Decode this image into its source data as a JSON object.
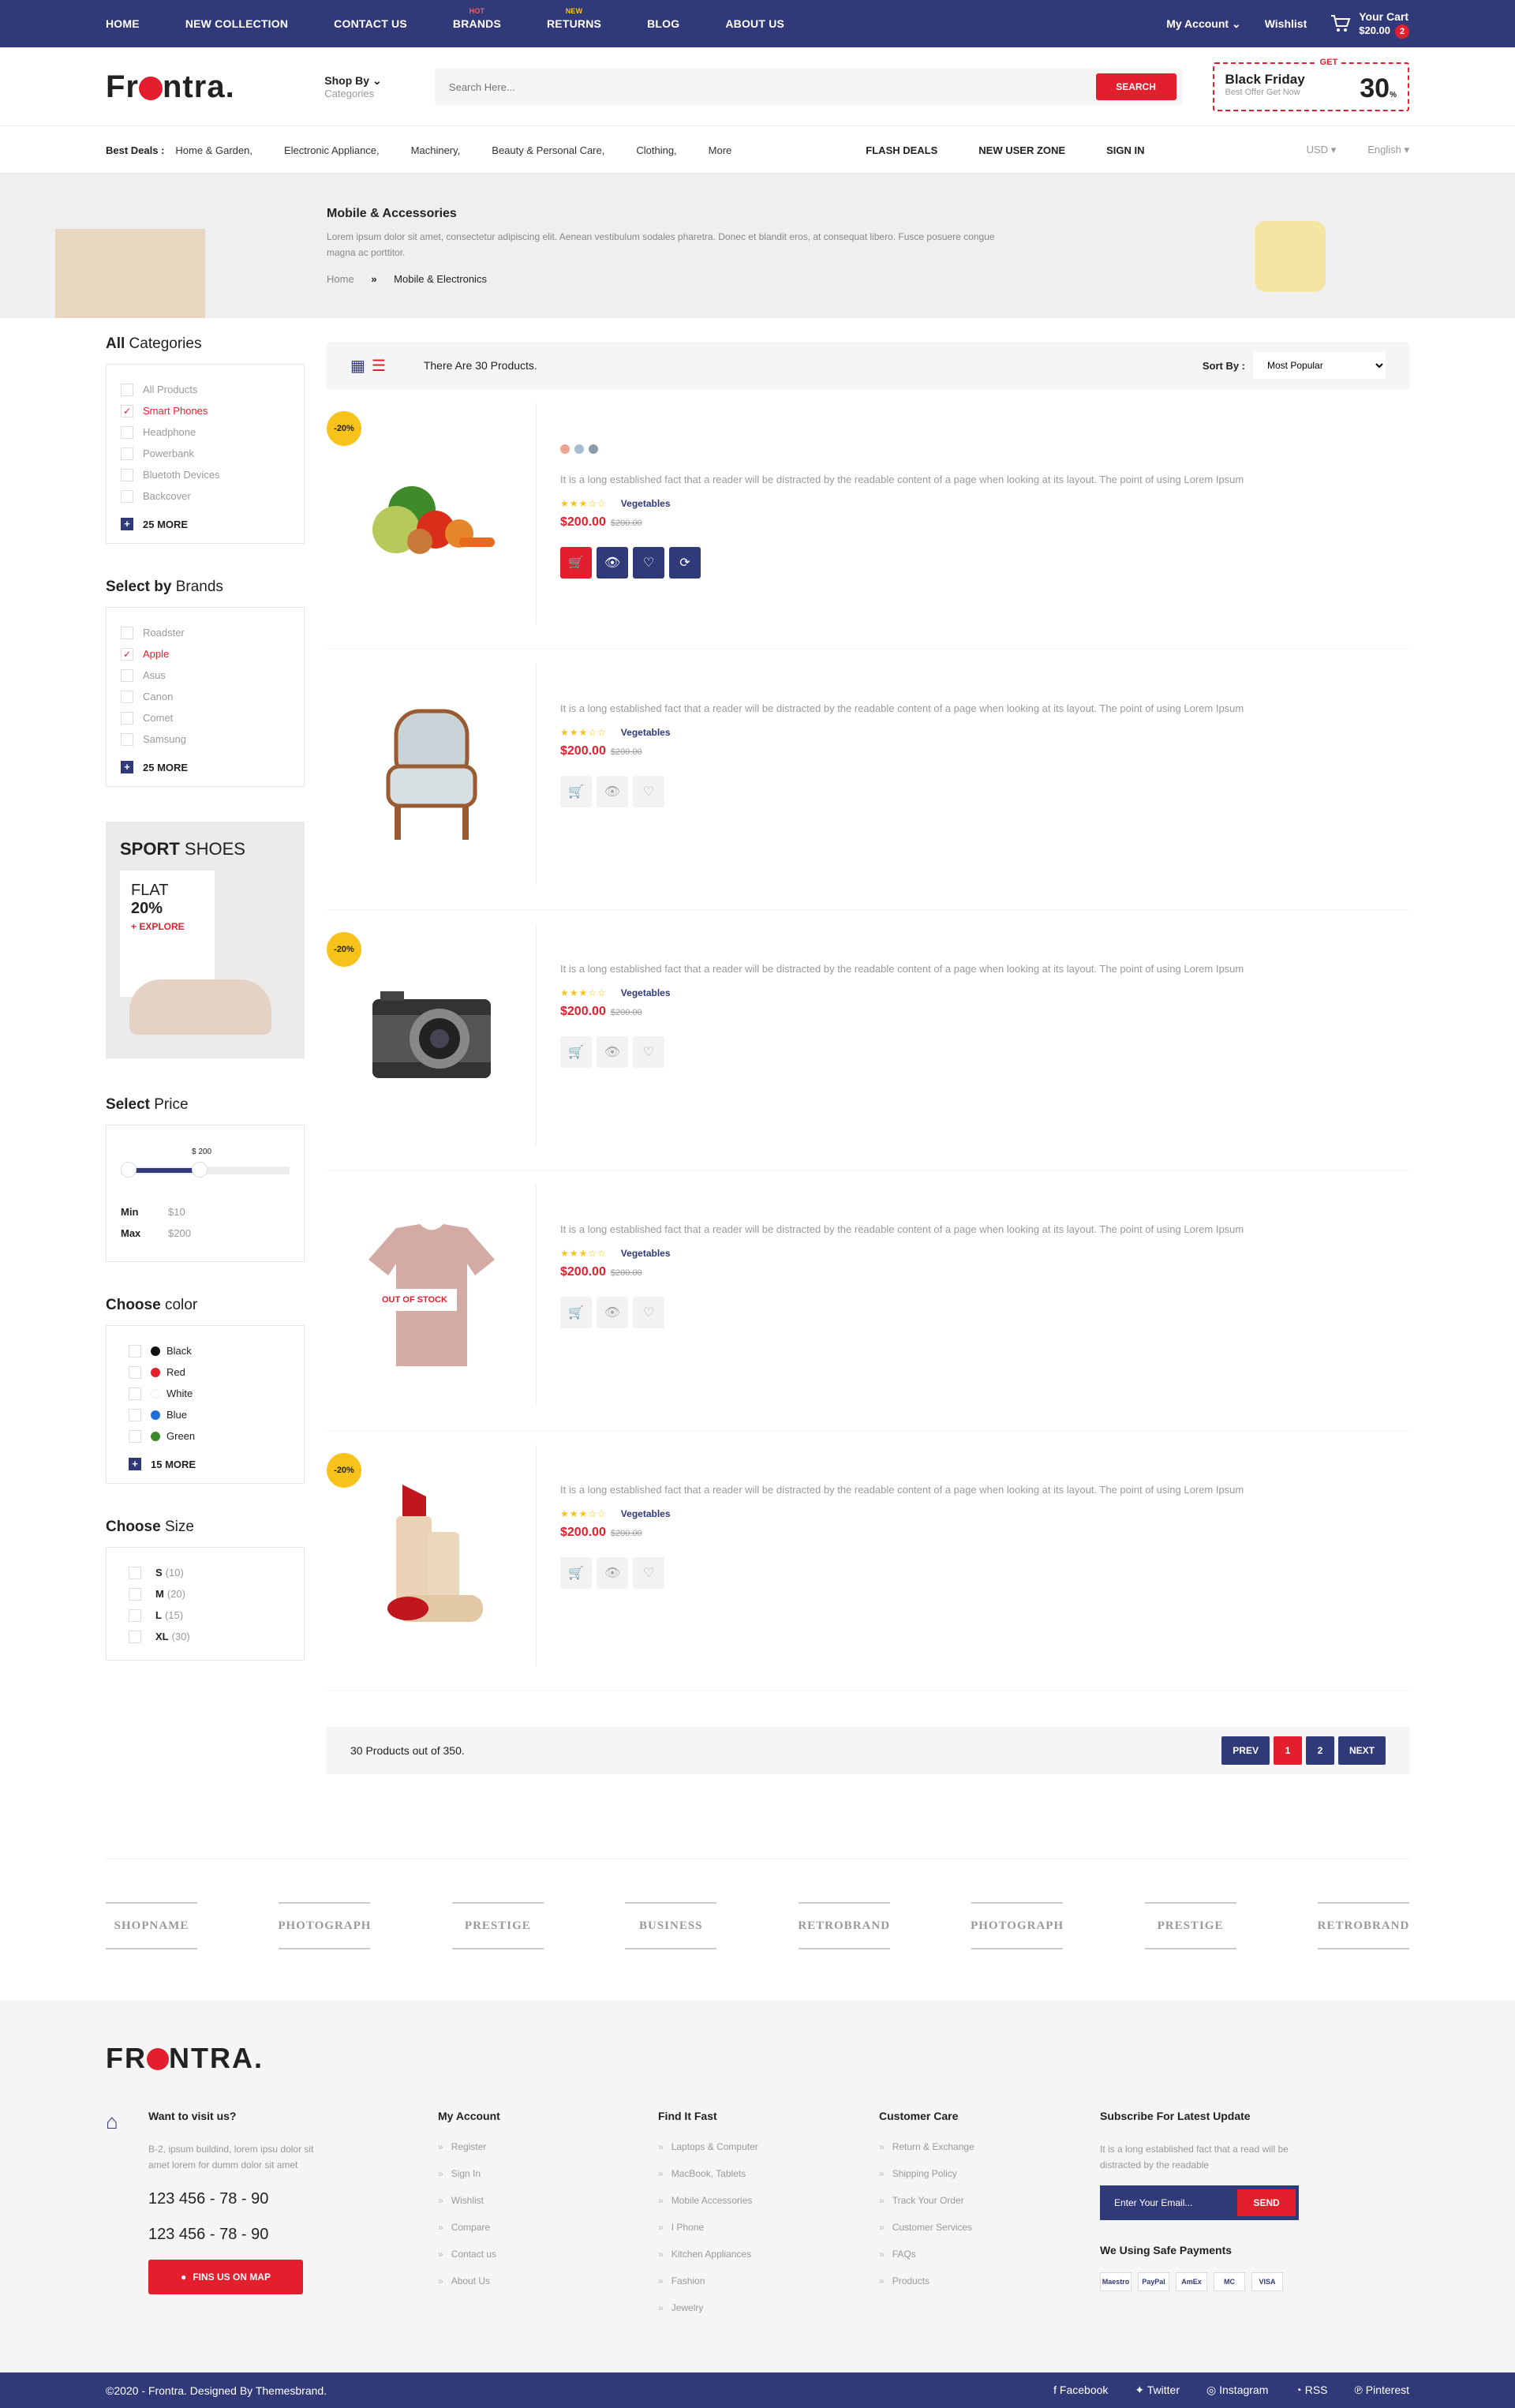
{
  "topbar": {
    "nav": [
      {
        "label": "HOME",
        "tag": ""
      },
      {
        "label": "NEW COLLECTION",
        "tag": ""
      },
      {
        "label": "CONTACT US",
        "tag": ""
      },
      {
        "label": "BRANDS",
        "tag": "HOT"
      },
      {
        "label": "RETURNS",
        "tag": "NEW"
      },
      {
        "label": "BLOG",
        "tag": ""
      },
      {
        "label": "ABOUT US",
        "tag": ""
      }
    ],
    "account": "My Account",
    "wishlist": "Wishlist",
    "cart_title": "Your Cart",
    "cart_total": "$20.00",
    "cart_count": "2"
  },
  "header": {
    "logo_pre": "Fr",
    "logo_post": "ntra.",
    "shopby": "Shop By",
    "shopby_sub": "Categories",
    "search_placeholder": "Search Here...",
    "search_button": "SEARCH",
    "promo_get": "GET",
    "promo_title": "Black Friday",
    "promo_sub": "Best Offer Get Now",
    "promo_pct": "30",
    "promo_pct_sign": "%"
  },
  "catbar": {
    "label": "Best Deals :",
    "cats": [
      "Home & Garden,",
      "Electronic Appliance,",
      "Machinery,",
      "Beauty & Personal Care,",
      "Clothing,",
      "More"
    ],
    "right": [
      "FLASH DEALS",
      "NEW USER ZONE",
      "SIGN IN"
    ],
    "currency": "USD",
    "language": "English"
  },
  "banner": {
    "title": "Mobile & Accessories",
    "text": "Lorem ipsum dolor sit amet, consectetur adipiscing elit. Aenean vestibulum sodales pharetra. Donec et blandit eros, at consequat libero. Fusce posuere congue magna ac porttitor.",
    "crumb_home": "Home",
    "crumb_sep": "»",
    "crumb_current": "Mobile & Electronics"
  },
  "sidebar": {
    "categories_title_a": "All",
    "categories_title_b": " Categories",
    "categories": [
      "All Products",
      "Smart Phones",
      "Headphone",
      "Powerbank",
      "Bluetoth Devices",
      "Backcover"
    ],
    "categories_more": "25 MORE",
    "brands_title_a": "Select by",
    "brands_title_b": " Brands",
    "brands": [
      "Roadster",
      "Apple",
      "Asus",
      "Canon",
      "Comet",
      "Samsung"
    ],
    "brands_more": "25 MORE",
    "ad_title_a": "SPORT",
    "ad_title_b": " SHOES",
    "ad_flat": "FLAT",
    "ad_pct": "20%",
    "ad_link": "+ EXPLORE",
    "price_title_a": "Select",
    "price_title_b": " Price",
    "price_value": "$ 200",
    "min_label": "Min",
    "min_value": "$10",
    "max_label": "Max",
    "max_value": "$200",
    "color_title_a": "Choose",
    "color_title_b": " color",
    "colors": [
      {
        "name": "Black",
        "hex": "#111111"
      },
      {
        "name": "Red",
        "hex": "#e31e2d"
      },
      {
        "name": "White",
        "hex": "#ffffff"
      },
      {
        "name": "Blue",
        "hex": "#1e6fd9"
      },
      {
        "name": "Green",
        "hex": "#3b8a2a"
      }
    ],
    "colors_more": "15 MORE",
    "size_title_a": "Choose",
    "size_title_b": " Size",
    "sizes": [
      {
        "label": "S",
        "count": "(10)"
      },
      {
        "label": "M",
        "count": "(20)"
      },
      {
        "label": "L",
        "count": "(15)"
      },
      {
        "label": "XL",
        "count": "(30)"
      }
    ]
  },
  "toolbar": {
    "count": "There Are 30 Products.",
    "sort_label": "Sort By :",
    "sort_value": "Most Popular"
  },
  "products": [
    {
      "sale": "-20%",
      "oos": "",
      "desc": "It is a long established fact that a reader will be distracted by the readable content of a page when looking at its layout. The point of using Lorem Ipsum",
      "stars": "★★★☆☆",
      "cat": "Vegetables",
      "price": "$200.00",
      "old": "$200.00",
      "img": "vegetables"
    },
    {
      "sale": "",
      "oos": "",
      "desc": "It is a long established fact that a reader will be distracted by the readable content of a page when looking at its layout. The point of using Lorem Ipsum",
      "stars": "★★★☆☆",
      "cat": "Vegetables",
      "price": "$200.00",
      "old": "$200.00",
      "img": "armchair"
    },
    {
      "sale": "-20%",
      "oos": "",
      "desc": "It is a long established fact that a reader will be distracted by the readable content of a page when looking at its layout. The point of using Lorem Ipsum",
      "stars": "★★★☆☆",
      "cat": "Vegetables",
      "price": "$200.00",
      "old": "$200.00",
      "img": "camera"
    },
    {
      "sale": "",
      "oos": "OUT OF STOCK",
      "desc": "It is a long established fact that a reader will be distracted by the readable content of a page when looking at its layout. The point of using Lorem Ipsum",
      "stars": "★★★☆☆",
      "cat": "Vegetables",
      "price": "$200.00",
      "old": "$200.00",
      "img": "tshirt"
    },
    {
      "sale": "-20%",
      "oos": "",
      "desc": "It is a long established fact that a reader will be distracted by the readable content of a page when looking at its layout. The point of using Lorem Ipsum",
      "stars": "★★★☆☆",
      "cat": "Vegetables",
      "price": "$200.00",
      "old": "$200.00",
      "img": "lipstick"
    }
  ],
  "swatches": [
    "#e9a58f",
    "#a9bcd0",
    "#8b9aa8"
  ],
  "pager": {
    "text": "30 Products out of 350.",
    "prev": "PREV",
    "p1": "1",
    "p2": "2",
    "next": "NEXT"
  },
  "brands": [
    "SHOPNAME",
    "PHOTOGRAPH",
    "PRESTIGE",
    "BUSINESS",
    "RETROBRAND",
    "PHOTOGRAPH",
    "PRESTIGE",
    "RETROBRAND"
  ],
  "footer": {
    "logo_pre": "FR",
    "logo_post": "NTRA.",
    "visit_title": "Want to visit us?",
    "visit_text": "B-2, ipsum buildind, lorem ipsu dolor sit amet lorem for dumm dolor sit amet",
    "phone1": "123 456 - 78 - 90",
    "phone2": "123 456 - 78 - 90",
    "map_button": "FINS US ON MAP",
    "account_title": "My Account",
    "account": [
      "Register",
      "Sign In",
      "Wishlist",
      "Compare",
      "Contact us",
      "About Us"
    ],
    "find_title": "Find It Fast",
    "find": [
      "Laptops & Computer",
      "MacBook, Tablets",
      "Mobile Accessories",
      "I Phone",
      "Kitchen Appliances",
      "Fashion",
      "Jewelry"
    ],
    "care_title": "Customer Care",
    "care": [
      "Return & Exchange",
      "Shipping Policy",
      "Track Your Order",
      "Customer Services",
      "FAQs",
      "Products"
    ],
    "sub_title": "Subscribe For Latest Update",
    "sub_text": "It is a long established fact that a read will be distracted by the readable",
    "email_placeholder": "Enter Your Email...",
    "send": "SEND",
    "pay_title": "We Using Safe Payments",
    "payments": [
      "Maestro",
      "PayPal",
      "AmEx",
      "MC",
      "VISA"
    ]
  },
  "bottom": {
    "copyright": "©2020 - Frontra. Designed By Themesbrand.",
    "social": [
      "Facebook",
      "Twitter",
      "Instagram",
      "RSS",
      "Pinterest"
    ]
  }
}
